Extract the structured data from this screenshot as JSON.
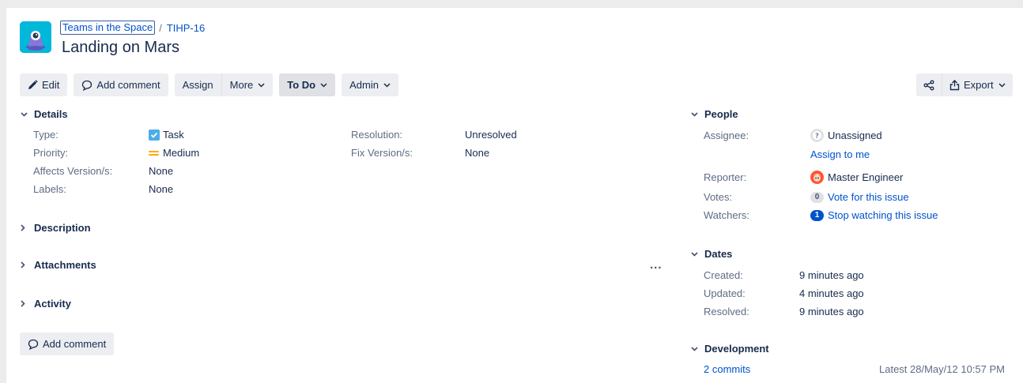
{
  "breadcrumb": {
    "project": "Teams in the Space",
    "separator": "/",
    "issue_key": "TIHP-16"
  },
  "issue": {
    "title": "Landing on Mars"
  },
  "toolbar": {
    "edit": "Edit",
    "add_comment": "Add comment",
    "assign": "Assign",
    "more": "More",
    "status": "To Do",
    "admin": "Admin",
    "export": "Export"
  },
  "details": {
    "heading": "Details",
    "type_label": "Type:",
    "type_value": "Task",
    "priority_label": "Priority:",
    "priority_value": "Medium",
    "affects_label": "Affects Version/s:",
    "affects_value": "None",
    "labels_label": "Labels:",
    "labels_value": "None",
    "resolution_label": "Resolution:",
    "resolution_value": "Unresolved",
    "fix_label": "Fix Version/s:",
    "fix_value": "None"
  },
  "sections": {
    "description": "Description",
    "attachments": "Attachments",
    "activity": "Activity",
    "more_actions": "..."
  },
  "bottom": {
    "add_comment": "Add comment"
  },
  "people": {
    "heading": "People",
    "assignee_label": "Assignee:",
    "assignee_value": "Unassigned",
    "assign_to_me": "Assign to me",
    "reporter_label": "Reporter:",
    "reporter_value": "Master Engineer",
    "votes_label": "Votes:",
    "votes_count": "0",
    "vote_link": "Vote for this issue",
    "watchers_label": "Watchers:",
    "watchers_count": "1",
    "watch_link": "Stop watching this issue"
  },
  "dates": {
    "heading": "Dates",
    "created_label": "Created:",
    "created_value": "9 minutes ago",
    "updated_label": "Updated:",
    "updated_value": "4 minutes ago",
    "resolved_label": "Resolved:",
    "resolved_value": "9 minutes ago"
  },
  "development": {
    "heading": "Development",
    "commits": "2 commits",
    "latest": "Latest 28/May/12 10:57 PM"
  },
  "colors": {
    "link": "#0052cc",
    "text": "#172b4d",
    "label": "#5e6c84",
    "button_bg": "#eceef1",
    "logo_bg": "#00b8d9",
    "task_icon": "#4bade8",
    "priority": "#ffab00",
    "reporter_avatar": "#ff5630"
  },
  "icons": {
    "edit": "pencil-icon",
    "comment": "comment-icon",
    "share": "share-icon",
    "export": "export-icon",
    "task": "task-checkbox-icon",
    "priority": "priority-medium-icon"
  }
}
